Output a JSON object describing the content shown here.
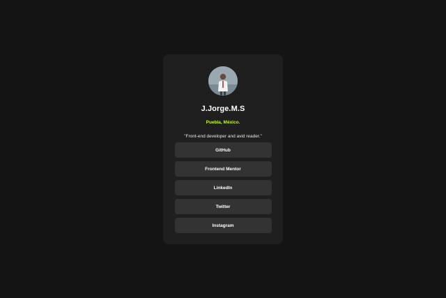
{
  "profile": {
    "name": "J.Jorge.M.S",
    "location": "Puebla, México.",
    "bio": "\"Front-end developer and avid reader.\"",
    "avatar_icon": "profile-photo"
  },
  "links": [
    {
      "label": "GitHub"
    },
    {
      "label": "Frontend Mentor"
    },
    {
      "label": "LinkedIn"
    },
    {
      "label": "Twitter"
    },
    {
      "label": "Instagram"
    }
  ],
  "colors": {
    "background": "#141414",
    "card": "#1f1f1f",
    "button": "#333333",
    "accent": "#c4f82a",
    "text": "#ffffff"
  }
}
